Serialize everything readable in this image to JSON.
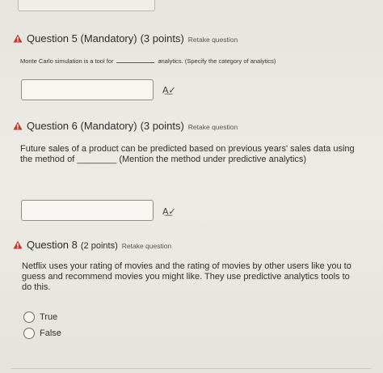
{
  "q5": {
    "label": "Question 5",
    "mandatory": "(Mandatory)",
    "points": "(3 points)",
    "retake": "Retake question",
    "text_before": "Monte Carlo simulation is a tool for",
    "text_after": "analytics. (Specify the category of analytics)",
    "answer_value": ""
  },
  "q6": {
    "label": "Question 6",
    "mandatory": "(Mandatory)",
    "points": "(3 points)",
    "retake": "Retake question",
    "line1": "Future sales of a product can be predicted based on previous years' sales data using",
    "line2": "the method of ________ (Mention the method under predictive analytics)",
    "answer_value": ""
  },
  "q8": {
    "label": "Question 8",
    "points": "(2 points)",
    "retake": "Retake question",
    "line1": "Netflix uses your rating of movies and the rating of movies by other users like you to",
    "line2": "guess and recommend movies you might like. They use predictive analytics tools to",
    "line3": "do this.",
    "options": [
      "True",
      "False"
    ]
  },
  "icons": {
    "warning": "warning-icon",
    "spellcheck": "spellcheck-icon"
  },
  "colors": {
    "warning": "#c0392b"
  }
}
